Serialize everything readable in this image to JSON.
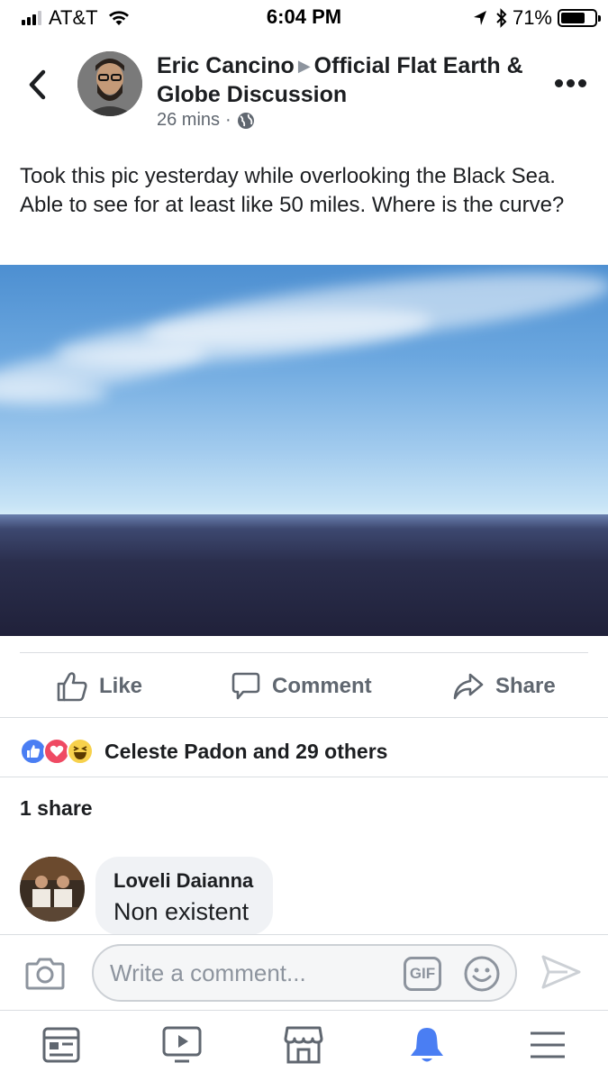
{
  "status_bar": {
    "carrier": "AT&T",
    "time": "6:04 PM",
    "battery_percent": "71%",
    "battery_level": 0.71,
    "signal_bars": 3
  },
  "post": {
    "author": "Eric Cancino",
    "group": "Official Flat Earth & Globe Discussion",
    "timestamp": "26 mins",
    "separator": "·",
    "privacy_icon": "globe-icon",
    "text": "Took this pic yesterday while overlooking the Black Sea. Able to see for at least like 50 miles. Where is the curve?"
  },
  "actions": {
    "like": "Like",
    "comment": "Comment",
    "share": "Share"
  },
  "reactions": {
    "icons": [
      "like-reaction-icon",
      "love-reaction-icon",
      "haha-reaction-icon"
    ],
    "summary": "Celeste Padon and 29 others"
  },
  "shares": {
    "label": "1 share"
  },
  "comments": [
    {
      "author": "Loveli Daianna",
      "text": "Non existent"
    }
  ],
  "composer": {
    "placeholder": "Write a comment...",
    "gif_label": "GIF"
  },
  "tabbar": {
    "tabs": [
      "news-feed-icon",
      "watch-icon",
      "marketplace-icon",
      "notifications-icon",
      "menu-icon"
    ],
    "active": "notifications-icon",
    "active_color": "#4a7ef3"
  },
  "colors": {
    "secondary_text": "#606770",
    "divider": "#dadde1",
    "like_blue": "#4a7ef3",
    "love_red": "#ef4a63",
    "haha_yellow": "#f7d14c"
  }
}
